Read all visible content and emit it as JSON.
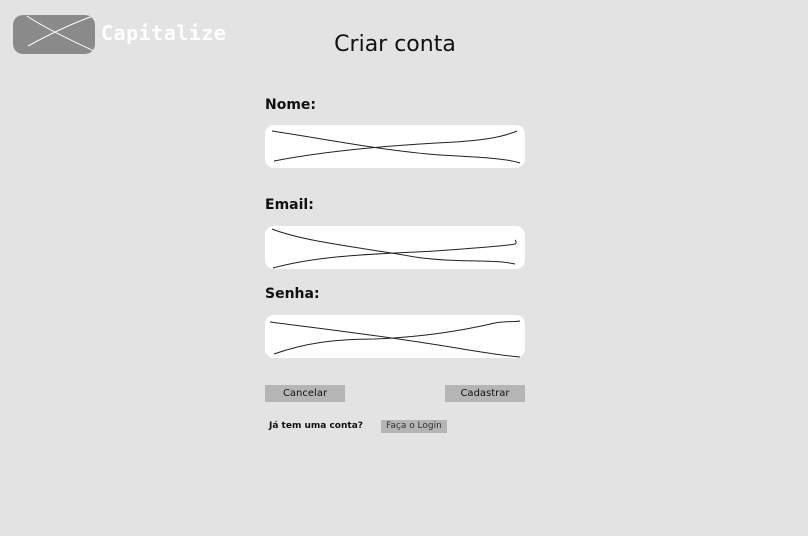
{
  "header": {
    "app_name": "Capitalize"
  },
  "page": {
    "title": "Criar conta"
  },
  "form": {
    "name": {
      "label": "Nome:",
      "value": ""
    },
    "email": {
      "label": "Email:",
      "value": ""
    },
    "password": {
      "label": "Senha:",
      "value": ""
    }
  },
  "actions": {
    "cancel_label": "Cancelar",
    "submit_label": "Cadastrar"
  },
  "login_prompt": {
    "question": "Já tem uma conta?",
    "link_label": "Faça o Login"
  },
  "colors": {
    "background": "#e3e3e3",
    "logo_placeholder": "#8a8a8a",
    "button": "#b5b5b5",
    "input": "#ffffff"
  }
}
